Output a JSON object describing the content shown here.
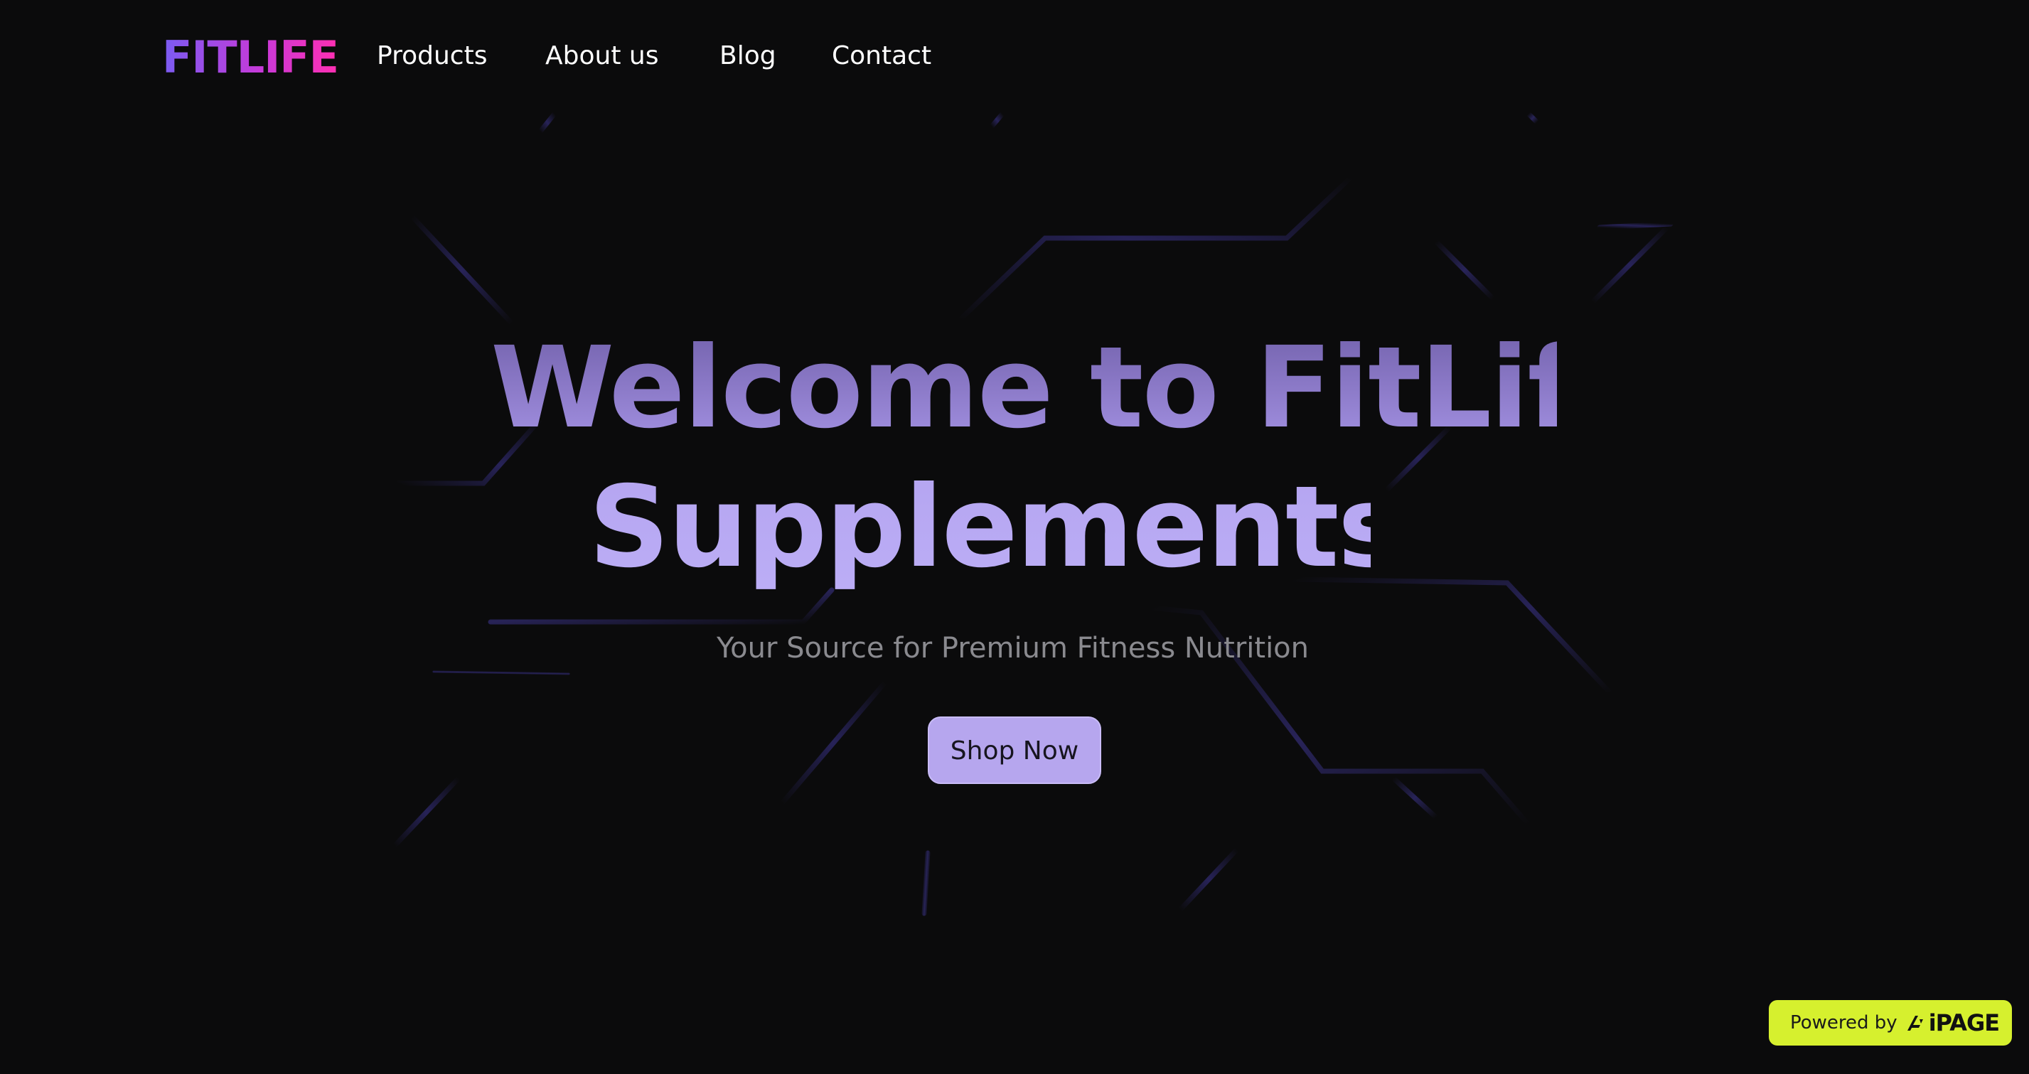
{
  "brand": {
    "logo_text": "FITLIFE",
    "gradient_start": "#7a5cf2",
    "gradient_end": "#ff2fb2"
  },
  "nav": {
    "items": [
      {
        "label": "Products"
      },
      {
        "label": "About us"
      },
      {
        "label": "Blog"
      },
      {
        "label": "Contact"
      }
    ]
  },
  "hero": {
    "title_line_1": "Welcome to FitLife",
    "title_line_2": "Supplements",
    "subtitle": "Your Source for Premium Fitness Nutrition",
    "cta_label": "Shop Now",
    "accent_color": "#b6a6ee"
  },
  "badge": {
    "prefix": "Powered by",
    "logo_text": "iPAGE",
    "icon": "aipage-logo-icon",
    "color": "#d6f02e"
  },
  "colors": {
    "background": "#0b0b0c",
    "circuit_lines": "#2a2560"
  }
}
